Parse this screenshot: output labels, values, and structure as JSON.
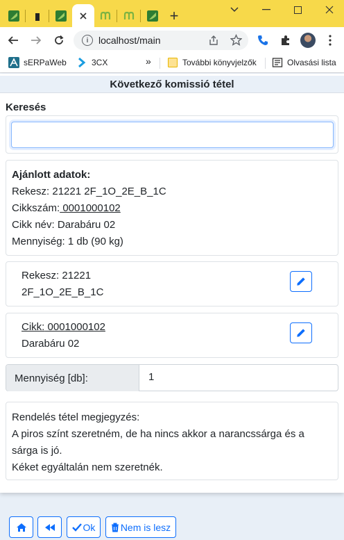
{
  "browser": {
    "url": "localhost/main",
    "tabs": [
      {
        "icon": "green-leaf-favicon",
        "color": "#5a9e3a"
      },
      {
        "icon": "black-bar-favicon",
        "color": "#222222"
      },
      {
        "icon": "green-leaf-favicon",
        "color": "#5a9e3a"
      },
      {
        "icon": "close-icon",
        "active": true
      },
      {
        "icon": "m-favicon",
        "color": "#7cb342"
      },
      {
        "icon": "m-favicon",
        "color": "#7cb342"
      },
      {
        "icon": "green-leaf-favicon",
        "color": "#5a9e3a"
      }
    ],
    "new_tab": "+",
    "bookmarks": {
      "b1": "sERPaWeb",
      "b2": "3CX",
      "more": "»",
      "b3": "További könyvjelzők",
      "b4": "Olvasási lista"
    }
  },
  "page": {
    "title": "Következő komissió tétel",
    "search_label": "Keresés",
    "search_value": "",
    "suggested": {
      "heading": "Ajánlott adatok:",
      "rack_prefix": "Rekesz: ",
      "rack_value": "21221 2F_1O_2E_B_1C",
      "item_no_prefix": "Cikkszám:",
      "item_no_value": " 0001000102",
      "item_name_prefix": "Cikk név: ",
      "item_name_value": "Darabáru 02",
      "qty_prefix": "Mennyiség: ",
      "qty_value": "1 db (90 kg)"
    },
    "rack_card": {
      "line1": "Rekesz: 21221",
      "line2": "2F_1O_2E_B_1C"
    },
    "item_card": {
      "prefix": "Cikk:",
      "code": " 0001000102",
      "name": "Darabáru 02"
    },
    "quantity": {
      "label": "Mennyiség [db]:",
      "value": "1"
    },
    "note": {
      "line1": "Rendelés tétel megjegyzés:",
      "line2": "A piros színt szeretném, de ha nincs akkor a narancssárga és a",
      "line3": "sárga is jó.",
      "line4": "Kéket egyáltalán nem szeretnék."
    },
    "buttons": {
      "ok": "Ok",
      "cancel": "Nem is lesz"
    }
  },
  "colors": {
    "primary": "#0d6efd",
    "tabstrip": "#f7d94a"
  }
}
